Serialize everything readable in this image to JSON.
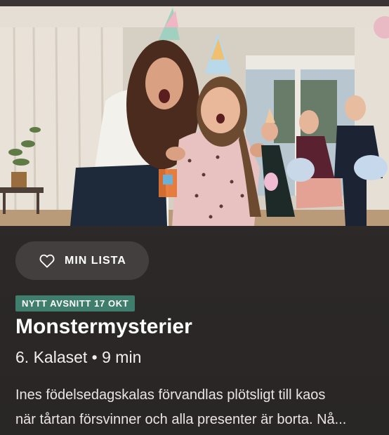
{
  "hero": {
    "image": "party-scene"
  },
  "actions": {
    "my_list_label": "MIN LISTA",
    "my_list_icon": "heart-outline-icon"
  },
  "badge": {
    "text": "NYTT AVSNITT 17 OKT",
    "color": "#3f7d6c"
  },
  "program": {
    "title": "Monstermysterier",
    "episode": "6. Kalaset • 9 min",
    "description_line1": "Ines födelsedagskalas förvandlas plötsligt till kaos",
    "description_line2": "när tårtan försvinner och alla presenter är borta. Nå..."
  },
  "colors": {
    "background": "#2b2828",
    "button": "#433f3e"
  }
}
